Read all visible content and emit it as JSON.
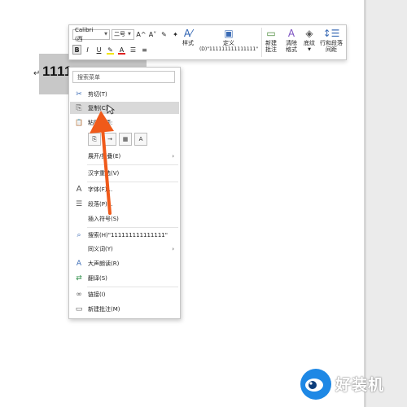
{
  "document": {
    "paragraph_mark": "↵",
    "selected_text": "1111"
  },
  "mini_toolbar": {
    "font_name": "Calibri (西",
    "font_size": "二号",
    "row1_buttons": [
      "A^",
      "A˅",
      "✎",
      "✦"
    ],
    "row2_buttons": [
      "B",
      "I",
      "U",
      "✎",
      "A"
    ],
    "style_label": "样式",
    "define_label": "定义",
    "define_sub": "(D)\"111111111111111\"",
    "new_comment_label": "新建\n批注",
    "clear_format_label": "清除\n格式",
    "shading_label": "底纹",
    "line_spacing_label": "行和段落\n间距",
    "highlight_color": "#f2e500",
    "font_color": "#e02020"
  },
  "context_menu": {
    "search_placeholder": "搜索菜单",
    "items": [
      {
        "label": "剪切(T)",
        "icon": "scissors-icon",
        "glyph": "✂"
      },
      {
        "label": "复制(C)",
        "icon": "copy-icon",
        "glyph": "⎘"
      },
      {
        "label": "粘贴选项:",
        "icon": "paste-icon",
        "glyph": "📋"
      },
      {
        "label": "展开/折叠(E)",
        "icon": "",
        "glyph": "",
        "submenu": true
      },
      {
        "label": "汉字重选(V)",
        "icon": "",
        "glyph": ""
      },
      {
        "label": "字体(F)...",
        "icon": "font-icon",
        "glyph": "A"
      },
      {
        "label": "段落(P)...",
        "icon": "paragraph-icon",
        "glyph": "☰"
      },
      {
        "label": "插入符号(S)",
        "icon": "",
        "glyph": ""
      },
      {
        "label": "搜索(H)\"111111111111111\"",
        "icon": "search-icon",
        "glyph": "⌕"
      },
      {
        "label": "同义词(Y)",
        "icon": "",
        "glyph": "",
        "submenu": true
      },
      {
        "label": "大声朗读(R)",
        "icon": "read-aloud-icon",
        "glyph": "A"
      },
      {
        "label": "翻译(S)",
        "icon": "translate-icon",
        "glyph": "⇄"
      },
      {
        "label": "链接(I)",
        "icon": "link-icon",
        "glyph": "∞"
      },
      {
        "label": "新建批注(M)",
        "icon": "comment-icon",
        "glyph": "▭"
      }
    ],
    "paste_option_buttons": [
      "⎘",
      "→",
      "▦",
      "A"
    ],
    "submenu_arrow": "›"
  },
  "watermark": {
    "text": "好装机"
  },
  "colors": {
    "arrow": "#f05a1a",
    "selection": "#c8c8c8",
    "watermark_blue": "#1e88e5"
  }
}
